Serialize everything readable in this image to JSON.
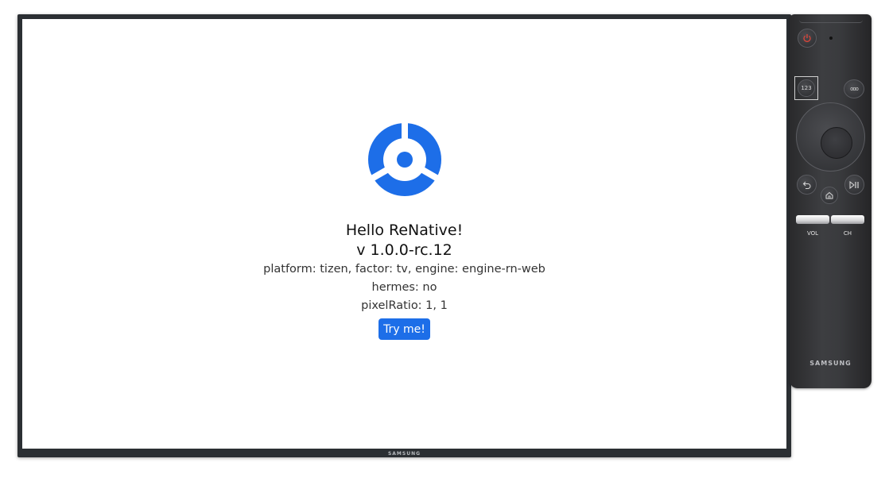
{
  "tv": {
    "brand": "SAMSUNG"
  },
  "app": {
    "greeting": "Hello ReNative!",
    "version": "v 1.0.0-rc.12",
    "platform_info": "platform: tizen, factor: tv, engine: engine-rn-web",
    "hermes_info": "hermes: no",
    "pixel_ratio_info": "pixelRatio: 1, 1",
    "try_button_label": "Try me!",
    "logo_icon": "renative-logo-icon",
    "accent_color": "#1d6ee8"
  },
  "remote": {
    "brand": "SAMSUNG",
    "power_icon": "power-icon",
    "number_button_label": "123",
    "more_button_label": "ooo",
    "back_icon": "back-arrow-icon",
    "home_icon": "home-icon",
    "play_pause_icon": "play-pause-icon",
    "vol_label": "VOL",
    "ch_label": "CH",
    "power_color": "#e0453a"
  }
}
